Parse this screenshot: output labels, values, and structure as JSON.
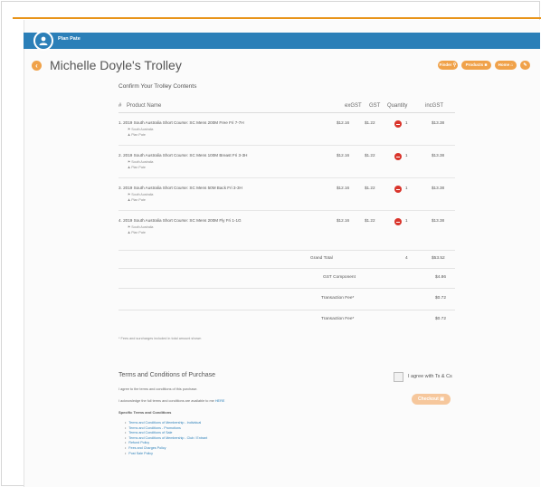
{
  "brand": {
    "name": "Plan Pate"
  },
  "page": {
    "title": "Michelle Doyle's Trolley",
    "back_glyph": "‹"
  },
  "toolbar": {
    "finder": {
      "label": "Finder",
      "icon": "search-icon"
    },
    "products": {
      "label": "Products",
      "icon": "shopping-bag-icon"
    },
    "home": {
      "label": "Home",
      "icon": "home-icon"
    },
    "extra": {
      "icon": "tag-icon"
    }
  },
  "trolley": {
    "heading": "Confirm Your Trolley Contents",
    "columns": {
      "num": "#",
      "product": "Product Name",
      "exgst": "exGST",
      "gst": "GST",
      "qty": "Quantity",
      "incgst": "incGST"
    },
    "items": [
      {
        "index": "1.",
        "name": "2019 South Australia Short Course: SC Mens 200M Free Fri 7-7H",
        "state": "South Australia",
        "person": "Plan Pate",
        "exgst": "$12.16",
        "gst": "$1.22",
        "qty": "1",
        "incgst": "$13.38"
      },
      {
        "index": "2.",
        "name": "2019 South Australia Short Course: SC Mens 100M Breast Fri 3-3H",
        "state": "South Australia",
        "person": "Plan Pate",
        "exgst": "$12.16",
        "gst": "$1.22",
        "qty": "1",
        "incgst": "$13.38"
      },
      {
        "index": "3.",
        "name": "2019 South Australia Short Course: SC Mens 50M Back Fri 3-3H",
        "state": "South Australia",
        "person": "Plan Pate",
        "exgst": "$12.16",
        "gst": "$1.22",
        "qty": "1",
        "incgst": "$13.38"
      },
      {
        "index": "4.",
        "name": "2019 South Australia Short Course: SC Mens 200M Fly Fri 1-1G",
        "state": "South Australia",
        "person": "Plan Pate",
        "exgst": "$12.16",
        "gst": "$1.22",
        "qty": "1",
        "incgst": "$13.38"
      }
    ],
    "totals": {
      "grand_label": "Grand Total",
      "grand_qty": "4",
      "grand_value": "$53.52",
      "gst_label": "GST Component",
      "gst_value": "$4.86",
      "fee1_label": "Transaction Fee*",
      "fee1_value": "$0.72",
      "fee2_label": "Transaction Fee*",
      "fee2_value": "$0.72"
    },
    "note": "* Fees and surcharges included in total amount shown"
  },
  "terms": {
    "title": "Terms and Conditions of Purchase",
    "line1": "I agree to the terms and conditions of this purchase.",
    "line2_prefix": "I acknowledge the full terms and conditions are available to me",
    "line2_link": "HERE",
    "specific_heading": "Specific Terms and Conditions",
    "links": [
      "Terms and Conditions of Membership - Individual",
      "Terms and Conditions - Promotions",
      "Terms and Conditions of Sale",
      "Terms and Conditions of Membership - Club / Entrant",
      "Refund Policy",
      "Fees and Charges Policy",
      "Post Sale Policy"
    ],
    "agree_label": "I agree with Ts & Cs",
    "checkout_label": "Checkout"
  },
  "colors": {
    "brand_blue": "#2b7fb8",
    "accent_orange": "#f0a24a",
    "remove_red": "#d9342b"
  }
}
